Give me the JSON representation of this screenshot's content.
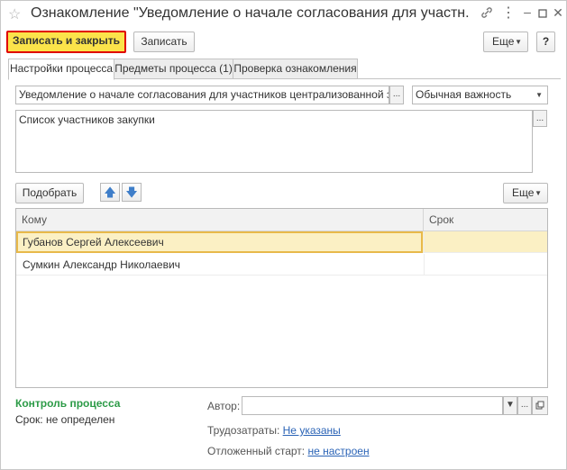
{
  "window": {
    "title": "Ознакомление \"Уведомление о начале согласования для участн...",
    "icons": [
      "star-icon",
      "link-icon",
      "more-icon",
      "minimize-icon",
      "maximize-icon",
      "close-icon"
    ]
  },
  "toolbar": {
    "save_close_label": "Записать и закрыть",
    "save_label": "Записать",
    "more_label": "Еще",
    "help_label": "?"
  },
  "tabs": [
    {
      "label": "Настройки процесса",
      "active": true
    },
    {
      "label": "Предметы процесса (1)",
      "active": false
    },
    {
      "label": "Проверка ознакомления",
      "active": false
    }
  ],
  "settings": {
    "subject_value": "Уведомление о начале согласования для участников централизованной закупки",
    "subject_btn": "...",
    "importance_value": "Обычная важность",
    "description_value": "Список участников закупки",
    "description_btn": "..."
  },
  "participants": {
    "pick_label": "Подобрать",
    "more_label": "Еще",
    "columns": [
      "Кому",
      "Срок"
    ],
    "rows": [
      {
        "to": "Губанов Сергей Алексеевич",
        "term": "",
        "selected": true
      },
      {
        "to": "Сумкин Александр Николаевич",
        "term": "",
        "selected": false
      }
    ]
  },
  "footer": {
    "control_title": "Контроль процесса",
    "term_label": "Срок:",
    "term_value": "не определен",
    "author_label": "Автор:",
    "author_value": "",
    "labor_label": "Трудозатраты:",
    "labor_value": "Не указаны",
    "delayed_label": "Отложенный старт:",
    "delayed_value": "не настроен"
  },
  "colors": {
    "primary_button": "#fbe34a",
    "primary_border": "#e00000",
    "link": "#2a63b6",
    "green_title": "#2c9b47",
    "selected_row": "#fbf0c4"
  }
}
